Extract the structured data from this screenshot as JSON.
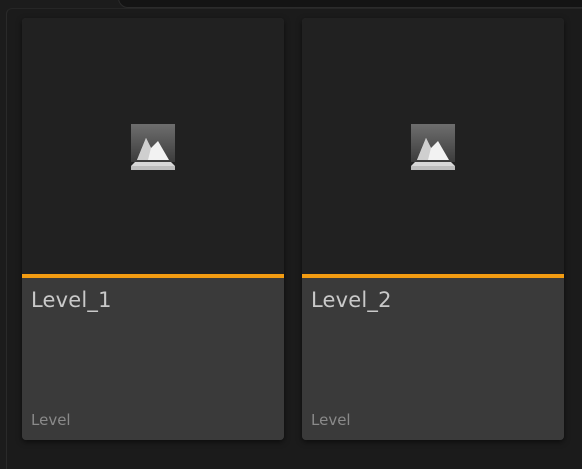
{
  "asset_browser": {
    "accent_color": "#f39c12",
    "tiles": [
      {
        "name": "Level_1",
        "type": "Level",
        "icon": "level-map-icon"
      },
      {
        "name": "Level_2",
        "type": "Level",
        "icon": "level-map-icon"
      }
    ]
  }
}
